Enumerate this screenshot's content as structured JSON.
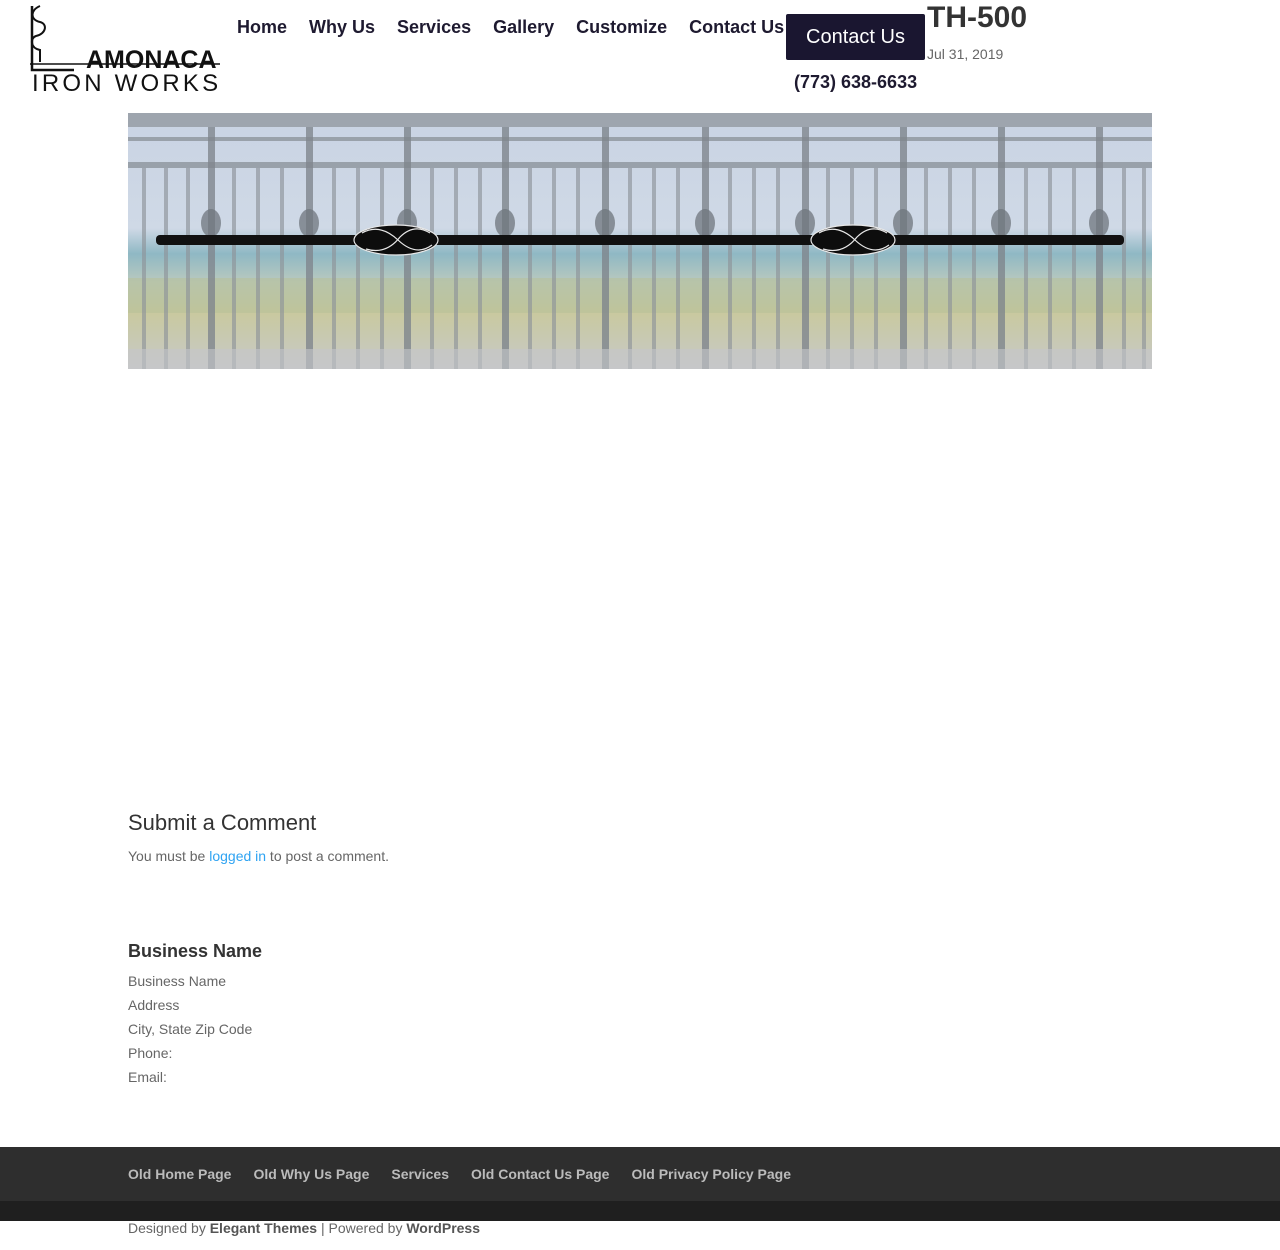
{
  "brand": {
    "logo_word_top": "AMONACA",
    "logo_word_bottom": "IRON WORKS",
    "logo_initial": "L"
  },
  "nav": {
    "items": [
      {
        "label": "Home"
      },
      {
        "label": "Why Us"
      },
      {
        "label": "Services"
      },
      {
        "label": "Gallery"
      },
      {
        "label": "Customize"
      },
      {
        "label": "Contact Us"
      }
    ],
    "cta_label": "Contact Us",
    "phone": "(773) 638-6633"
  },
  "post": {
    "title": "TH-500",
    "date": "Jul 31, 2019"
  },
  "comments": {
    "heading": "Submit a Comment",
    "note_prefix": "You must be ",
    "note_link": "logged in",
    "note_suffix": " to post a comment."
  },
  "business": {
    "heading": "Business Name",
    "lines": [
      "Business Name",
      "Address",
      "City, State Zip Code",
      "Phone:",
      "Email:"
    ]
  },
  "footer": {
    "links": [
      {
        "label": "Old Home Page"
      },
      {
        "label": "Old Why Us Page"
      },
      {
        "label": "Services"
      },
      {
        "label": "Old Contact Us Page"
      },
      {
        "label": "Old Privacy Policy Page"
      }
    ],
    "credits_prefix": "Designed by ",
    "credits_theme": "Elegant Themes",
    "credits_mid": " | Powered by ",
    "credits_platform": "WordPress"
  },
  "colors": {
    "nav_text": "#1e1a30",
    "cta_bg": "#1a1630",
    "link": "#2ea3f2",
    "footer_bg": "#2e2e2e"
  }
}
